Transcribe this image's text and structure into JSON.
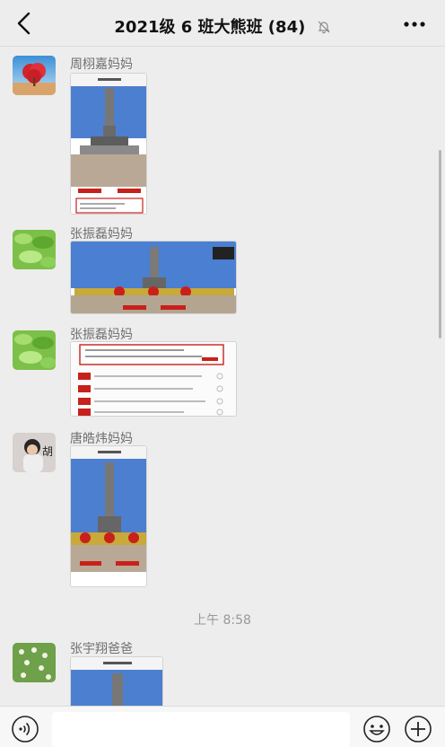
{
  "header": {
    "title": "2021级 6 班大熊班 (84)",
    "back_icon": "chevron-left-icon",
    "mute_icon": "bell-off-icon",
    "more_icon": "ellipsis-icon"
  },
  "messages": [
    {
      "sender": "周栩嘉妈妈",
      "avatar": "heart-tree-avatar",
      "image": "monument-screenshot-portrait"
    },
    {
      "sender": "张振磊妈妈",
      "avatar": "green-leaves-avatar",
      "image": "monument-screenshot-landscape"
    },
    {
      "sender": "张振磊妈妈",
      "avatar": "green-leaves-avatar",
      "image": "quiz-result-screenshot"
    },
    {
      "sender": "唐皓炜妈妈",
      "avatar": "child-photo-avatar",
      "avatar_text": "胡",
      "image": "monument-screenshot-portrait"
    }
  ],
  "timestamp": "上午 8:58",
  "last_message": {
    "sender": "张宇翔爸爸",
    "avatar": "flowers-avatar",
    "image": "monument-screenshot-portrait"
  },
  "footer": {
    "voice_icon": "voice-icon",
    "input_value": "",
    "emoji_icon": "emoji-icon",
    "plus_icon": "plus-circle-icon"
  },
  "colors": {
    "background": "#ededed",
    "banner_red": "#c8201a",
    "sky_blue": "#4d7fd0"
  }
}
